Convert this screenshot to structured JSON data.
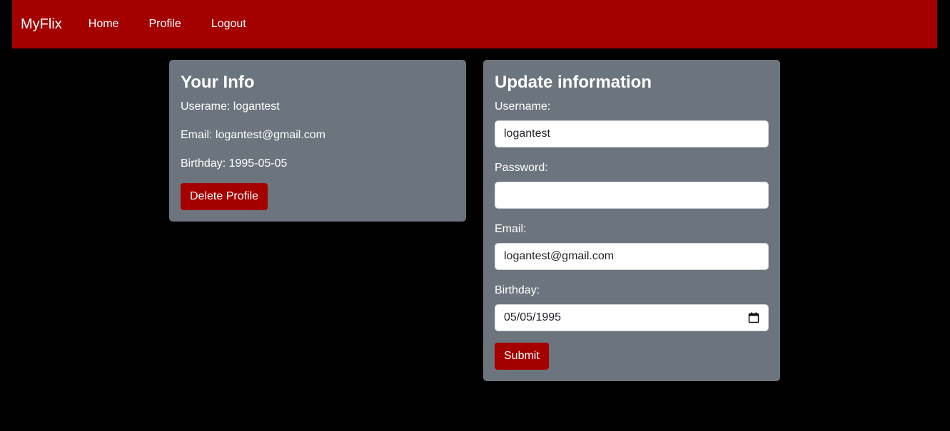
{
  "navbar": {
    "brand": "MyFlix",
    "links": [
      "Home",
      "Profile",
      "Logout"
    ]
  },
  "info_card": {
    "title": "Your Info",
    "username_line": "Userame: logantest",
    "email_line": "Email: logantest@gmail.com",
    "birthday_line": "Birthday: 1995-05-05",
    "delete_label": "Delete Profile"
  },
  "update_card": {
    "title": "Update information",
    "username_label": "Username:",
    "username_value": "logantest",
    "password_label": "Password:",
    "password_value": "",
    "email_label": "Email:",
    "email_value": "logantest@gmail.com",
    "birthday_label": "Birthday:",
    "birthday_value": "05/05/1995",
    "submit_label": "Submit"
  },
  "colors": {
    "accent": "#a50000",
    "card": "#6c757d",
    "background": "#000000"
  }
}
